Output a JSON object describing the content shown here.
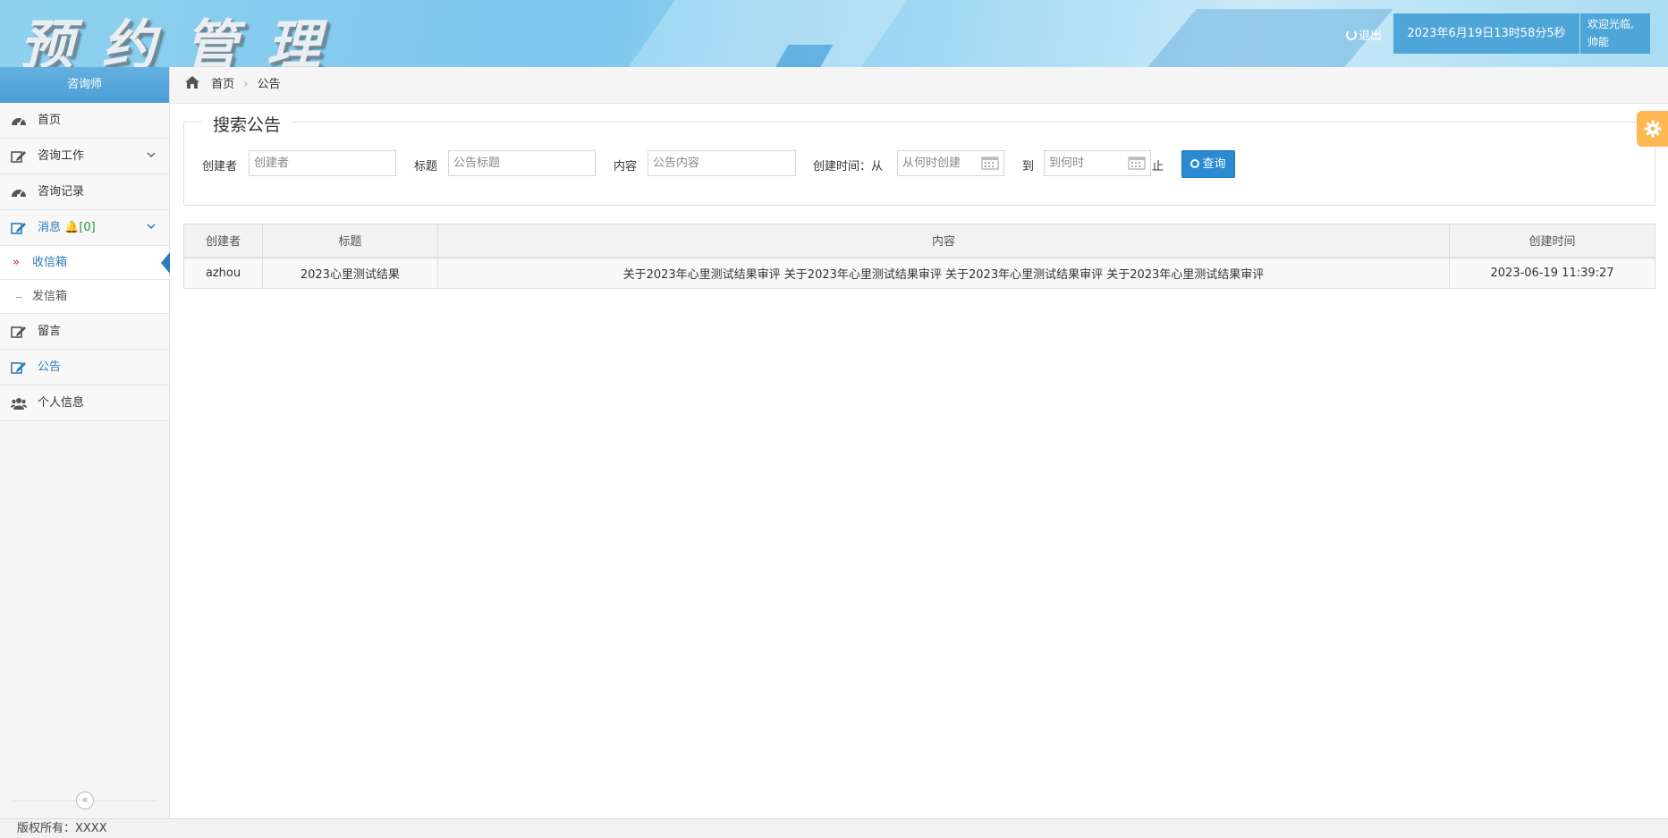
{
  "header": {
    "logo_text": "预约管理",
    "logout_label": "退出",
    "clock_text": "2023年6月19日13时58分5秒",
    "welcome_line1": "欢迎光临,",
    "welcome_line2": "帅能"
  },
  "sidebar": {
    "role_title": "咨询师",
    "items": [
      {
        "label": "首页"
      },
      {
        "label": "咨询工作"
      },
      {
        "label": "咨询记录"
      },
      {
        "label": "消息",
        "badge": "[0]"
      },
      {
        "label": "留言"
      },
      {
        "label": "公告"
      },
      {
        "label": "个人信息"
      }
    ],
    "subitems": [
      {
        "label": "收信箱"
      },
      {
        "label": "发信箱"
      }
    ],
    "collapse_glyph": "«"
  },
  "breadcrumb": {
    "home": "首页",
    "current": "公告"
  },
  "search": {
    "legend": "搜索公告",
    "creator_label": "创建者",
    "creator_placeholder": "创建者",
    "title_label": "标题",
    "title_placeholder": "公告标题",
    "content_label": "内容",
    "content_placeholder": "公告内容",
    "time_label": "创建时间：从",
    "from_placeholder": "从何时创建",
    "to_label": "到",
    "to_placeholder": "到何时",
    "until_label": "止",
    "query_label": "查询"
  },
  "table": {
    "headers": [
      "创建者",
      "标题",
      "内容",
      "创建时间"
    ],
    "rows": [
      [
        "azhou",
        "2023心里测试结果",
        "关于2023年心里测试结果审评 关于2023年心里测试结果审评 关于2023年心里测试结果审评 关于2023年心里测试结果审评",
        "2023-06-19 11:39:27"
      ]
    ]
  },
  "footer": {
    "copyright": "版权所有：XXXX"
  }
}
